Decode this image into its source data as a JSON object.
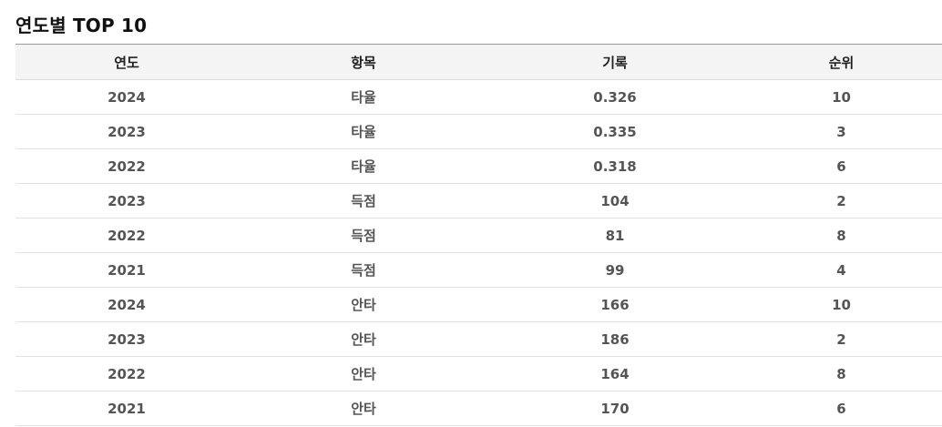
{
  "section": {
    "title": "연도별 TOP 10"
  },
  "table": {
    "headers": [
      "연도",
      "항목",
      "기록",
      "순위"
    ],
    "rows": [
      [
        "2024",
        "타율",
        "0.326",
        "10"
      ],
      [
        "2023",
        "타율",
        "0.335",
        "3"
      ],
      [
        "2022",
        "타율",
        "0.318",
        "6"
      ],
      [
        "2023",
        "득점",
        "104",
        "2"
      ],
      [
        "2022",
        "득점",
        "81",
        "8"
      ],
      [
        "2021",
        "득점",
        "99",
        "4"
      ],
      [
        "2024",
        "안타",
        "166",
        "10"
      ],
      [
        "2023",
        "안타",
        "186",
        "2"
      ],
      [
        "2022",
        "안타",
        "164",
        "8"
      ],
      [
        "2021",
        "안타",
        "170",
        "6"
      ]
    ]
  }
}
